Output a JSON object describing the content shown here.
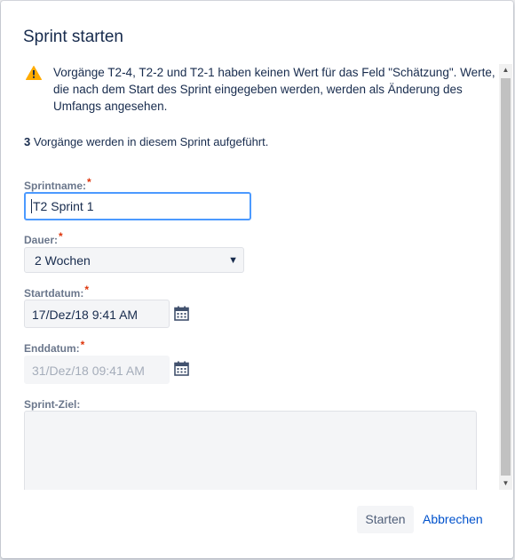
{
  "dialog": {
    "title": "Sprint starten",
    "warning": "Vorgänge T2-4, T2-2 und T2-1 haben keinen Wert für das Feld \"Schätzung\". Werte, die nach dem Start des Sprint eingegeben werden, werden als Änderung des Umfangs angesehen.",
    "issues_count": "3",
    "issues_text": "Vorgänge werden in diesem Sprint aufgeführt.",
    "required_marker": "*"
  },
  "form": {
    "sprint_name": {
      "label": "Sprintname:",
      "value": "T2 Sprint 1"
    },
    "duration": {
      "label": "Dauer:",
      "value": "2 Wochen"
    },
    "start_date": {
      "label": "Startdatum:",
      "value": "17/Dez/18 9:41 AM"
    },
    "end_date": {
      "label": "Enddatum:",
      "value": "31/Dez/18 09:41 AM"
    },
    "goal": {
      "label": "Sprint-Ziel:",
      "value": ""
    }
  },
  "footer": {
    "start_label": "Starten",
    "cancel_label": "Abbrechen"
  },
  "icons": {
    "warning": "warning-icon",
    "calendar": "calendar-icon",
    "dropdown": "chevron-down-icon"
  },
  "colors": {
    "warning": "#ffab00",
    "required": "#de350b",
    "link": "#0052cc",
    "focus_border": "#4c9aff"
  }
}
